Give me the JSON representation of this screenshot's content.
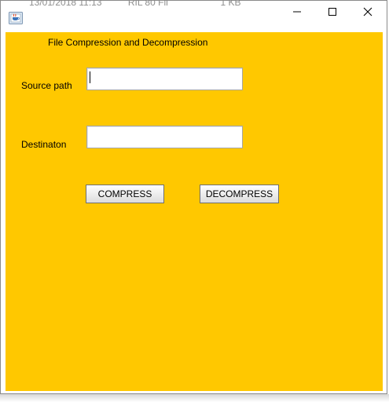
{
  "window": {
    "background_text": "13/01/2018 11:13          RIL 80 Fil                    1 KB",
    "controls": {
      "minimize_icon": "minimize-icon",
      "maximize_icon": "maximize-icon",
      "close_icon": "close-icon"
    }
  },
  "form": {
    "heading": "File Compression and Decompression",
    "source_label": "Source path",
    "source_value": "",
    "destination_label": "Destinaton",
    "destination_value": "",
    "compress_label": "COMPRESS",
    "decompress_label": "DECOMPRESS"
  },
  "colors": {
    "panel_background": "#ffc800",
    "titlebar": "#ffffff"
  }
}
